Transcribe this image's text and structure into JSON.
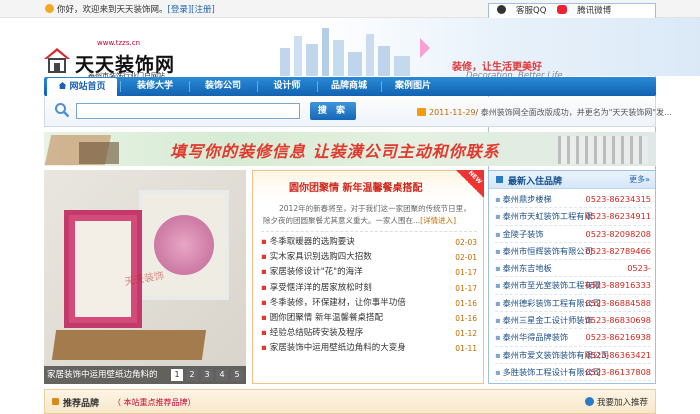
{
  "topbar": {
    "greeting": "你好，欢迎来到天天装饰网。",
    "login": "[登录]",
    "register": "[注册]",
    "service": "客服QQ",
    "weibo": "腾讯微博"
  },
  "header": {
    "url": "www.tzzs.cn",
    "title": "天天装饰网",
    "subtitle": "泰州市装饰行业门户网站",
    "slogan": "装修，让生活更美好",
    "slogan_en": "Decoration, Better Life..."
  },
  "nav": {
    "items": [
      "网站首页",
      "装修大学",
      "装饰公司",
      "设计师",
      "品牌商城",
      "案例图片"
    ]
  },
  "search": {
    "button": "搜 索",
    "news_date": "2011-11-29",
    "news_text": "/ 泰州装饰网全面改版成功，并更名为\"天天装饰网\"发..."
  },
  "banner": {
    "text": "填写你的装修信息  让装潢公司主动和你联系"
  },
  "feature": {
    "caption": "家居装饰中运用壁纸边角料的",
    "pages": [
      "1",
      "2",
      "3",
      "4",
      "5"
    ],
    "watermark": "天天装饰"
  },
  "article": {
    "badge": "NEW",
    "title": "圆你团聚情  新年温馨餐桌搭配",
    "summary": "2012年的新春将至，对于我们这一家团聚的传统节日里，除夕夜的团圆聚餐尤其意义重大。一家人围在...",
    "more": "[详情进入]",
    "items": [
      {
        "title": "冬季取暖器的选购要诀",
        "date": "02-03"
      },
      {
        "title": "实木家具识别选购四大招数",
        "date": "02-01"
      },
      {
        "title": "家居装修设计\"花\"的海洋",
        "date": "01-17"
      },
      {
        "title": "享受惬洋洋的居家放松时刻",
        "date": "01-17"
      },
      {
        "title": "冬季装修，环保建材，让你事半功倍",
        "date": "01-16"
      },
      {
        "title": "圆你团聚情 新年温馨餐桌搭配",
        "date": "01-16"
      },
      {
        "title": "经验总结贴砖安装及程序",
        "date": "01-12"
      },
      {
        "title": "家居装饰中运用壁纸边角料的大变身",
        "date": "01-11"
      }
    ]
  },
  "companies": {
    "title": "最新入住品牌",
    "more": "更多»",
    "items": [
      {
        "name": "泰州鼎步楼梯",
        "phone": "0523-86234315"
      },
      {
        "name": "泰州市天虹装饰工程有限",
        "phone": "0523-86234911"
      },
      {
        "name": "金陵子装饰",
        "phone": "0523-82098208"
      },
      {
        "name": "泰州市恒辉装饰有限公司",
        "phone": "0523-82789466"
      },
      {
        "name": "泰州东吉地板",
        "phone": "0523-"
      },
      {
        "name": "泰州市至光室装饰工程有限",
        "phone": "0523-88916333"
      },
      {
        "name": "泰州德彩装饰工程有限公司",
        "phone": "0523-86884588"
      },
      {
        "name": "泰州三星金工设计师装饰",
        "phone": "0523-86830698"
      },
      {
        "name": "泰州华得品牌装饰",
        "phone": "0523-86216938"
      },
      {
        "name": "泰州市爱文装饰装饰有限公司",
        "phone": "0523-86363421"
      },
      {
        "name": "多胜装饰工程设计有限公司",
        "phone": "0523-86137808"
      }
    ]
  },
  "recommend": {
    "title": "推荐品牌",
    "sub": "（ 本站重点推荐品牌）",
    "join": "我要加入推荐"
  },
  "colors": {
    "nav_blue": "#1163b1",
    "accent_red": "#e2382d",
    "date_orange": "#c66a00"
  }
}
